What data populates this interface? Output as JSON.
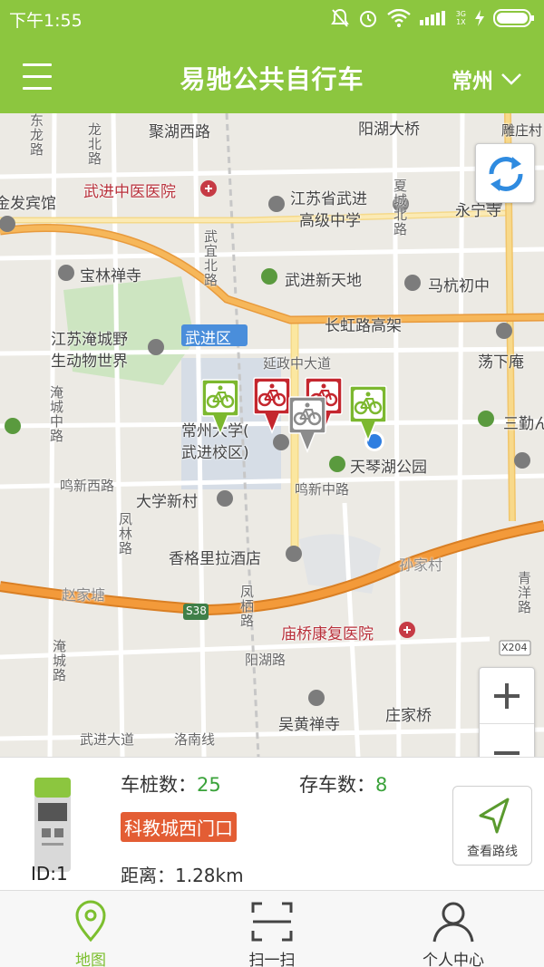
{
  "status_bar": {
    "time": "下午1:55",
    "network_type_top": "3G",
    "network_type_bottom": "1X"
  },
  "header": {
    "title": "易驰公共自行车",
    "city": "常州"
  },
  "colors": {
    "brand_green": "#8cc63f",
    "marker_green": "#7cb82f",
    "marker_red": "#c4262e",
    "marker_gray": "#8c8c8c",
    "station_name_bg": "#e35d34",
    "stat_value_green": "#3aa23a"
  },
  "map": {
    "labels": [
      {
        "text": "聚湖西路"
      },
      {
        "text": "阳湖大桥"
      },
      {
        "text": "雕庄村"
      },
      {
        "text": "武进中医医院"
      },
      {
        "text": "江苏省武进"
      },
      {
        "text": "高级中学"
      },
      {
        "text": "永宁寺"
      },
      {
        "text": "金发宾馆"
      },
      {
        "text": "宝林禅寺"
      },
      {
        "text": "武进新天地"
      },
      {
        "text": "马杭初中"
      },
      {
        "text": "长虹路高架"
      },
      {
        "text": "江苏淹城野"
      },
      {
        "text": "生动物世界"
      },
      {
        "text": "武进区"
      },
      {
        "text": "延政中大道"
      },
      {
        "text": "荡下庵"
      },
      {
        "text": "常州大学("
      },
      {
        "text": "武进校区)"
      },
      {
        "text": "天琴湖公园"
      },
      {
        "text": "三勤ん"
      },
      {
        "text": "鸣新西路"
      },
      {
        "text": "鸣新中路"
      },
      {
        "text": "大学新村"
      },
      {
        "text": "香格里拉酒店"
      },
      {
        "text": "孙家村"
      },
      {
        "text": "赵家塘"
      },
      {
        "text": "S38"
      },
      {
        "text": "庙桥康复医院"
      },
      {
        "text": "阳湖路"
      },
      {
        "text": "吴黄禅寺"
      },
      {
        "text": "庄家桥"
      },
      {
        "text": "武进大道"
      },
      {
        "text": "洛南线"
      },
      {
        "text": "X204"
      }
    ],
    "vertical_labels": [
      {
        "text": "东龙路"
      },
      {
        "text": "龙北路"
      },
      {
        "text": "武宜北路"
      },
      {
        "text": "夏城北路"
      },
      {
        "text": "淹城中路"
      },
      {
        "text": "凤林路"
      },
      {
        "text": "凤栖路"
      },
      {
        "text": "淹城路"
      },
      {
        "text": "青洋路"
      }
    ],
    "markers": [
      {
        "color": "green"
      },
      {
        "color": "red"
      },
      {
        "color": "red"
      },
      {
        "color": "gray"
      },
      {
        "color": "green"
      }
    ],
    "refresh_icon": "refresh-icon",
    "zoom_in_icon": "plus-icon",
    "zoom_out_icon": "minus-icon"
  },
  "station": {
    "pile_count_label": "车桩数：",
    "pile_count": "25",
    "bike_count_label": "存车数：",
    "bike_count": "8",
    "name": "科教城西门口",
    "id_text": "ID:1",
    "distance_text": "距离：1.28km",
    "route_button_label": "查看路线"
  },
  "bottom_nav": {
    "items": [
      {
        "label": "地图",
        "icon": "map-pin-icon",
        "active": true
      },
      {
        "label": "扫一扫",
        "icon": "scan-icon",
        "active": false
      },
      {
        "label": "个人中心",
        "icon": "user-icon",
        "active": false
      }
    ]
  }
}
